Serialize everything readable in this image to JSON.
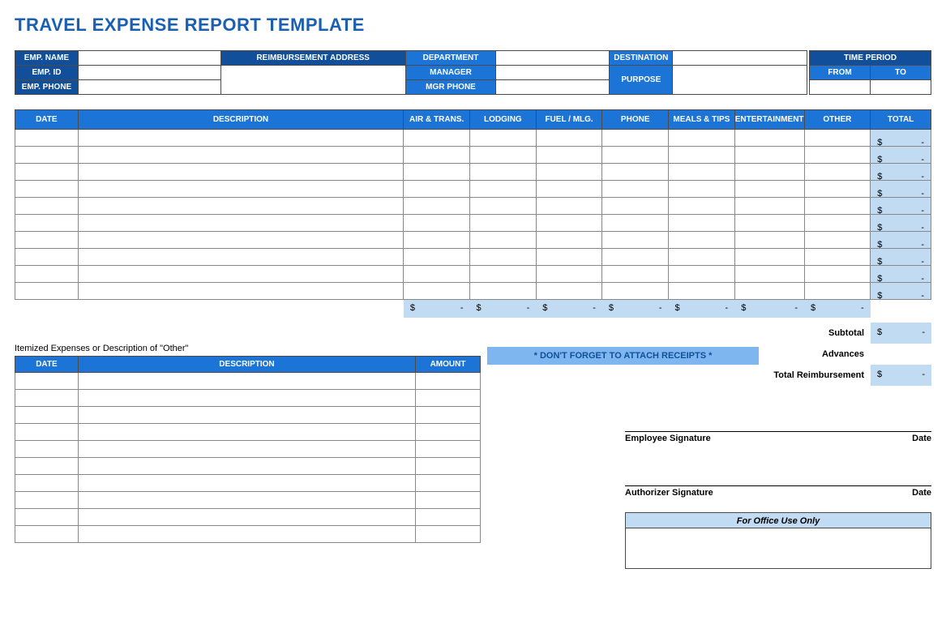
{
  "title": "TRAVEL EXPENSE REPORT TEMPLATE",
  "info": {
    "emp_name": "EMP. NAME",
    "reimb_addr": "REIMBURSEMENT ADDRESS",
    "department": "DEPARTMENT",
    "destination": "DESTINATION",
    "time_period": "TIME PERIOD",
    "emp_id": "EMP. ID",
    "manager": "MANAGER",
    "purpose": "PURPOSE",
    "from": "FROM",
    "to": "TO",
    "emp_phone": "EMP. PHONE",
    "mgr_phone": "MGR PHONE"
  },
  "expense_headers": {
    "date": "DATE",
    "description": "DESCRIPTION",
    "air": "AIR & TRANS.",
    "lodging": "LODGING",
    "fuel": "FUEL / MLG.",
    "phone": "PHONE",
    "meals": "MEALS & TIPS",
    "ent": "ENTERTAINMENT",
    "other": "OTHER",
    "total": "TOTAL"
  },
  "dash": "-",
  "dollar": "$",
  "receipts_msg": "* DON'T FORGET TO ATTACH RECEIPTS *",
  "summary": {
    "subtotal": "Subtotal",
    "advances": "Advances",
    "total_reimb": "Total Reimbursement"
  },
  "itemized_title": "Itemized Expenses or Description of \"Other\"",
  "itemized_headers": {
    "date": "DATE",
    "description": "DESCRIPTION",
    "amount": "AMOUNT"
  },
  "sig": {
    "employee": "Employee Signature",
    "authorizer": "Authorizer Signature",
    "date": "Date"
  },
  "office": "For Office Use Only"
}
